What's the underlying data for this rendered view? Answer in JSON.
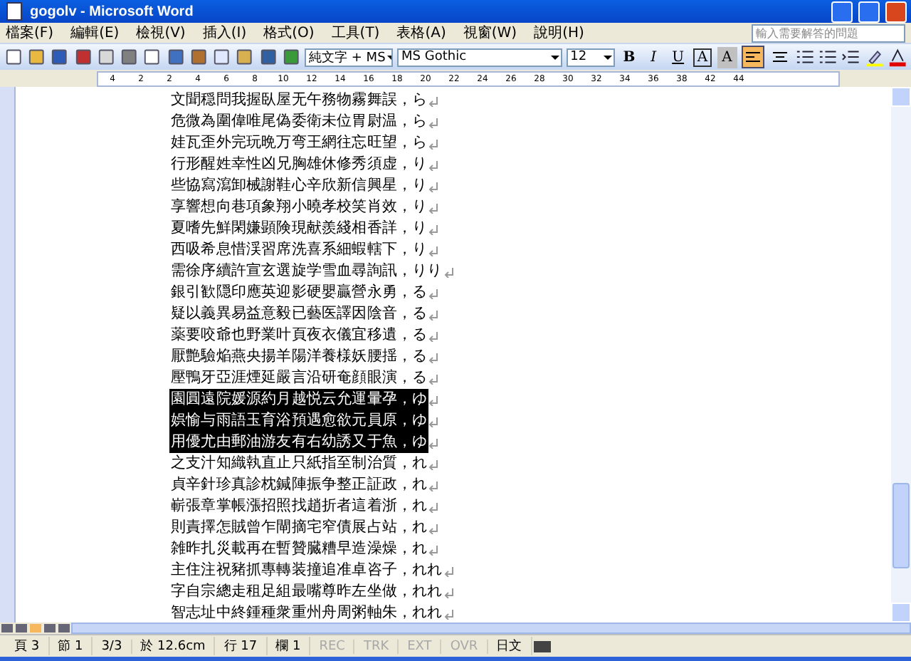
{
  "window": {
    "title": "gogolv - Microsoft Word"
  },
  "menu": {
    "items": [
      "檔案(F)",
      "編輯(E)",
      "檢視(V)",
      "插入(I)",
      "格式(O)",
      "工具(T)",
      "表格(A)",
      "視窗(W)",
      "說明(H)"
    ]
  },
  "help_box": {
    "placeholder": "輸入需要解答的問題"
  },
  "toolbar": {
    "style": "純文字 + MS",
    "font": "MS Gothic",
    "size": "12",
    "format_buttons": [
      {
        "kind": "bold",
        "label": "B"
      },
      {
        "kind": "italic",
        "label": "I"
      },
      {
        "kind": "underline",
        "label": "U"
      },
      {
        "kind": "border",
        "label": "A"
      },
      {
        "kind": "shade",
        "label": "A"
      }
    ],
    "align_buttons": [
      {
        "selected": true
      },
      {
        "selected": false
      }
    ]
  },
  "ruler": {
    "labels": [
      "4",
      "2",
      "2",
      "4",
      "6",
      "8",
      "10",
      "12",
      "14",
      "16",
      "18",
      "20",
      "22",
      "24",
      "26",
      "28",
      "30",
      "32",
      "34",
      "36",
      "38",
      "42",
      "44"
    ]
  },
  "document": {
    "lines": [
      {
        "text": "文聞穏問我握臥屋无午務物霧舞誤，ら",
        "selected": false
      },
      {
        "text": "危微為圍偉唯尾偽委衛未位胃尉温，ら",
        "selected": false
      },
      {
        "text": "娃瓦歪外完玩晩万弯王網往忘旺望，ら",
        "selected": false
      },
      {
        "text": "行形醒姓幸性凶兄胸雄休修秀須虚，り",
        "selected": false
      },
      {
        "text": "些協寫瀉卸械謝鞋心辛欣新信興星，り",
        "selected": false
      },
      {
        "text": "享響想向巷項象翔小曉孝校笑肖效，り",
        "selected": false
      },
      {
        "text": "夏嗜先鮮閑嫌顕険現献羨綫相香詳，り",
        "selected": false
      },
      {
        "text": "西吸希息惜渓習席洗喜系細蝦轄下，り",
        "selected": false
      },
      {
        "text": "需徐序續許宣玄選旋学雪血尋詢訊，りり",
        "selected": false
      },
      {
        "text": "銀引歓隠印應英迎影硬嬰贏營永勇，る",
        "selected": false
      },
      {
        "text": "疑以義異易益意毅已藝医譯因陰音，る",
        "selected": false
      },
      {
        "text": "薬要咬爺也野業叶頁夜衣儀宜移遺，る",
        "selected": false
      },
      {
        "text": "厭艶驗焔燕央揚羊陽洋養様妖腰揺，る",
        "selected": false
      },
      {
        "text": "壓鴨牙亞涯煙延嚴言沿研奄顔眼演，る",
        "selected": false
      },
      {
        "text": "園圓遠院媛源約月越悦云允運暈孕，ゆ",
        "selected": true
      },
      {
        "text": "娯愉与雨語玉育浴預遇愈欲元員原，ゆ",
        "selected": true
      },
      {
        "text": "用優尤由郵油游友有右幼誘又于魚，ゆ",
        "selected": true
      },
      {
        "text": "之支汁知織執直止只紙指至制治質，れ",
        "selected": false
      },
      {
        "text": "貞辛針珍真診枕鍼陣振争整正証政，れ",
        "selected": false
      },
      {
        "text": "嶄張章掌帳漲招照找趙折者這着浙，れ",
        "selected": false
      },
      {
        "text": "則責擇怎賊曾乍閘摘宅窄債展占站，れ",
        "selected": false
      },
      {
        "text": "雑昨扎災載再在暫贊臓糟早造澡燥，れ",
        "selected": false
      },
      {
        "text": "主住注祝豬抓專轉装撞追准卓咨子，れれ",
        "selected": false
      },
      {
        "text": "字自宗總走租足組最嘴尊昨左坐做，れれ",
        "selected": false
      },
      {
        "text": "智志址中終鍾種衆重州舟周粥軸朱，れれ",
        "selected": false
      }
    ]
  },
  "status_bar": {
    "fields": [
      {
        "text": "頁 3",
        "disabled": false
      },
      {
        "text": "節 1",
        "disabled": false
      },
      {
        "text": "3/3",
        "disabled": false
      },
      {
        "text": "於 12.6cm",
        "disabled": false
      },
      {
        "text": "行 17",
        "disabled": false
      },
      {
        "text": "欄 1",
        "disabled": false
      },
      {
        "text": "REC",
        "disabled": true
      },
      {
        "text": "TRK",
        "disabled": true
      },
      {
        "text": "EXT",
        "disabled": true
      },
      {
        "text": "OVR",
        "disabled": true
      },
      {
        "text": "日文",
        "disabled": false
      }
    ]
  }
}
